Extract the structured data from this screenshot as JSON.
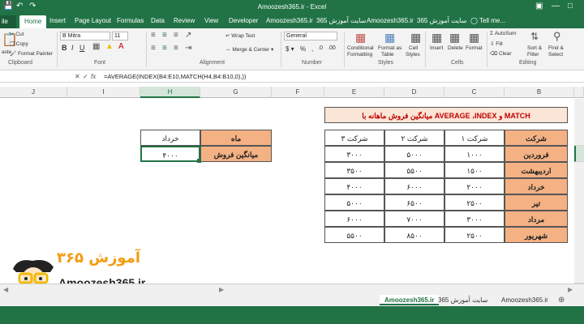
{
  "window": {
    "title": "Amoozesh365.ir - Excel"
  },
  "tabs": {
    "file": "ile",
    "home": "Home",
    "insert": "Insert",
    "page_layout": "Page Layout",
    "formulas": "Formulas",
    "data": "Data",
    "review": "Review",
    "view": "View",
    "developer": "Developer",
    "t1": "Amoozesh365.ir",
    "t2": "سایت آموزش 365",
    "t3": "Amoozesh365.ir",
    "t4": "سایت آموزش 365",
    "tell_me": "Tell me..."
  },
  "ribbon": {
    "cut": "Cut",
    "copy": "Copy",
    "format_painter": "Format Painter",
    "paste": "aste",
    "clipboard": "Clipboard",
    "font_name": "B Mitra",
    "font_size": "11",
    "font": "Font",
    "wrap_text": "Wrap Text",
    "merge_center": "Merge & Center",
    "alignment": "Alignment",
    "number_format": "General",
    "number": "Number",
    "conditional": "Conditional",
    "formatting": "Formatting",
    "format_as": "Format as",
    "table": "Table",
    "cell": "Cell",
    "styles_btn": "Styles",
    "styles": "Styles",
    "insert": "Insert",
    "delete": "Delete",
    "format": "Format",
    "cells": "Cells",
    "autosum": "AutoSum",
    "fill": "Fill",
    "clear": "Clear",
    "sort_filter": "Sort &",
    "filter": "Filter",
    "find_select": "Find &",
    "select": "Select",
    "editing": "Editing"
  },
  "formula_bar": {
    "formula": "=AVERAGE(INDEX(B4:E10,MATCH(H4,B4:B10,0),))"
  },
  "columns": [
    "J",
    "I",
    "H",
    "G",
    "F",
    "E",
    "D",
    "C",
    "B"
  ],
  "table_title": "میانگین فروش ماهانه با AVERAGE ،INDEX و MATCH",
  "headers": [
    "شرکت",
    "شرکت ۱",
    "شرکت ۲",
    "شرکت ۳"
  ],
  "rows": [
    [
      "فروردین",
      "۱۰۰۰",
      "۵۰۰۰",
      "۳۰۰۰"
    ],
    [
      "اردیبهشت",
      "۱۵۰۰",
      "۵۵۰۰",
      "۳۵۰۰"
    ],
    [
      "خرداد",
      "۲۰۰۰",
      "۶۰۰۰",
      "۴۰۰۰"
    ],
    [
      "تیر",
      "۲۵۰۰",
      "۶۵۰۰",
      "۵۰۰۰"
    ],
    [
      "مرداد",
      "۳۰۰۰",
      "۷۰۰۰",
      "۶۰۰۰"
    ],
    [
      "شهریور",
      "۲۵۰۰",
      "۸۵۰۰",
      "۵۵۰۰"
    ]
  ],
  "lookup": {
    "label_header": "ماه",
    "label_value": "خرداد",
    "result_label": "میانگین فروش",
    "result_value": "۴۰۰۰"
  },
  "sheets": [
    "Amoozesh365.ir",
    "سایت آموزش 365",
    "Amoozesh365.ir"
  ],
  "logo": {
    "text": "Amoozesh365.ir",
    "persian": "آموزش ۳۶۵"
  },
  "colors": {
    "excel_green": "#217346",
    "header_orange": "#f4b183",
    "title_bg": "#fbe5d6",
    "title_red": "#c00000"
  }
}
